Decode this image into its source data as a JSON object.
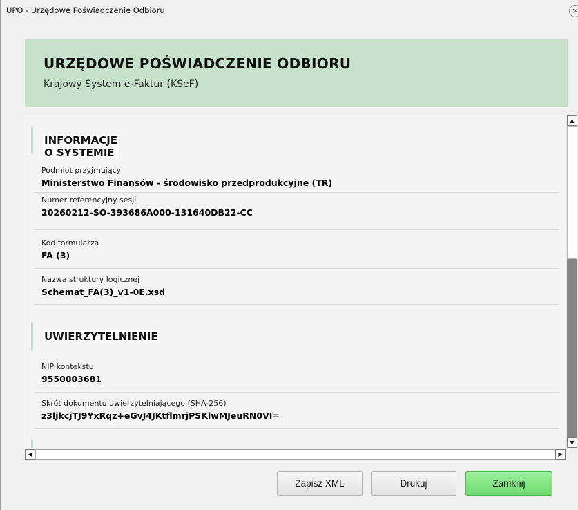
{
  "window": {
    "title": "UPO - Urzędowe Poświadczenie Odbioru",
    "close_glyph": "×"
  },
  "header": {
    "title": "URZĘDOWE POŚWIADCZENIE ODBIORU",
    "subtitle": "Krajowy System e-Faktur (KSeF)"
  },
  "sections": {
    "system": {
      "title": "INFORMACJE O SYSTEMIE",
      "fields": [
        {
          "label": "Podmiot przyjmujący",
          "value": "Ministerstwo Finansów - środowisko przedprodukcyjne (TR)"
        },
        {
          "label": "Numer referencyjny sesji",
          "value": "20260212-SO-393686A000-131640DB22-CC"
        },
        {
          "label": "Kod formularza",
          "value": "FA (3)"
        },
        {
          "label": "Nazwa struktury logicznej",
          "value": "Schemat_FA(3)_v1-0E.xsd"
        }
      ]
    },
    "auth": {
      "title": "UWIERZYTELNIENIE",
      "fields": [
        {
          "label": "NIP kontekstu",
          "value": "9550003681"
        },
        {
          "label": "Skrót dokumentu uwierzytelniającego (SHA-256)",
          "value": "z3ljkcjTJ9YxRqz+eGvJ4JKtflmrjPSKlwMJeuRN0VI="
        }
      ]
    }
  },
  "scrollbars": {
    "up_glyph": "▲",
    "down_glyph": "▼",
    "left_glyph": "◀",
    "right_glyph": "▶"
  },
  "buttons": {
    "save_xml": "Zapisz XML",
    "print": "Drukuj",
    "close": "Zamknij"
  },
  "colors": {
    "header_band": "#c6e2cb",
    "primary_button": "#7ee07c",
    "section_accent": "#c4dfc7"
  }
}
